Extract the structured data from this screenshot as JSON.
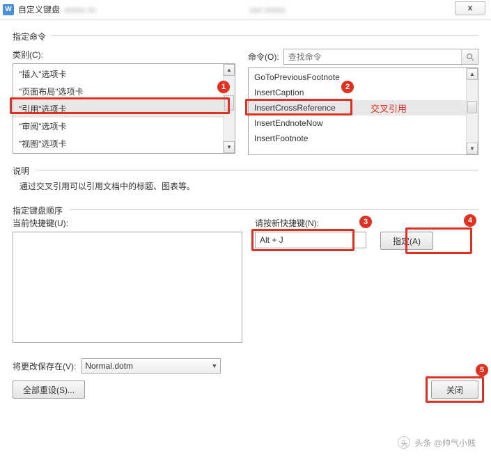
{
  "title": "自定义键盘",
  "section1": {
    "legend": "指定命令",
    "category_label": "类别(C):",
    "command_label": "命令(O):",
    "search_placeholder": "查找命令",
    "categories": [
      "\"插入\"选项卡",
      "\"页面布局\"选项卡",
      "\"引用\"选项卡",
      "\"审阅\"选项卡",
      "\"视图\"选项卡"
    ],
    "selected_category_index": 2,
    "commands": [
      "GoToPreviousFootnote",
      "InsertCaption",
      "InsertCrossReference",
      "InsertEndnoteNow",
      "InsertFootnote"
    ],
    "selected_command_index": 2,
    "annotation": "交叉引用"
  },
  "section2": {
    "legend": "说明",
    "text": "通过交叉引用可以引用文档中的标题、图表等。"
  },
  "section3": {
    "legend": "指定键盘顺序",
    "current_label": "当前快捷键(U):",
    "new_label": "请按新快捷键(N):",
    "new_value": "Alt + J",
    "assign_btn": "指定(A)"
  },
  "footer": {
    "save_in_label": "将更改保存在(V):",
    "save_in_value": "Normal.dotm",
    "reset_btn": "全部重设(S)...",
    "close_btn": "关闭"
  },
  "badges": {
    "b1": "1",
    "b2": "2",
    "b3": "3",
    "b4": "4",
    "b5": "5"
  },
  "watermark": "头条 @帅气小贱"
}
